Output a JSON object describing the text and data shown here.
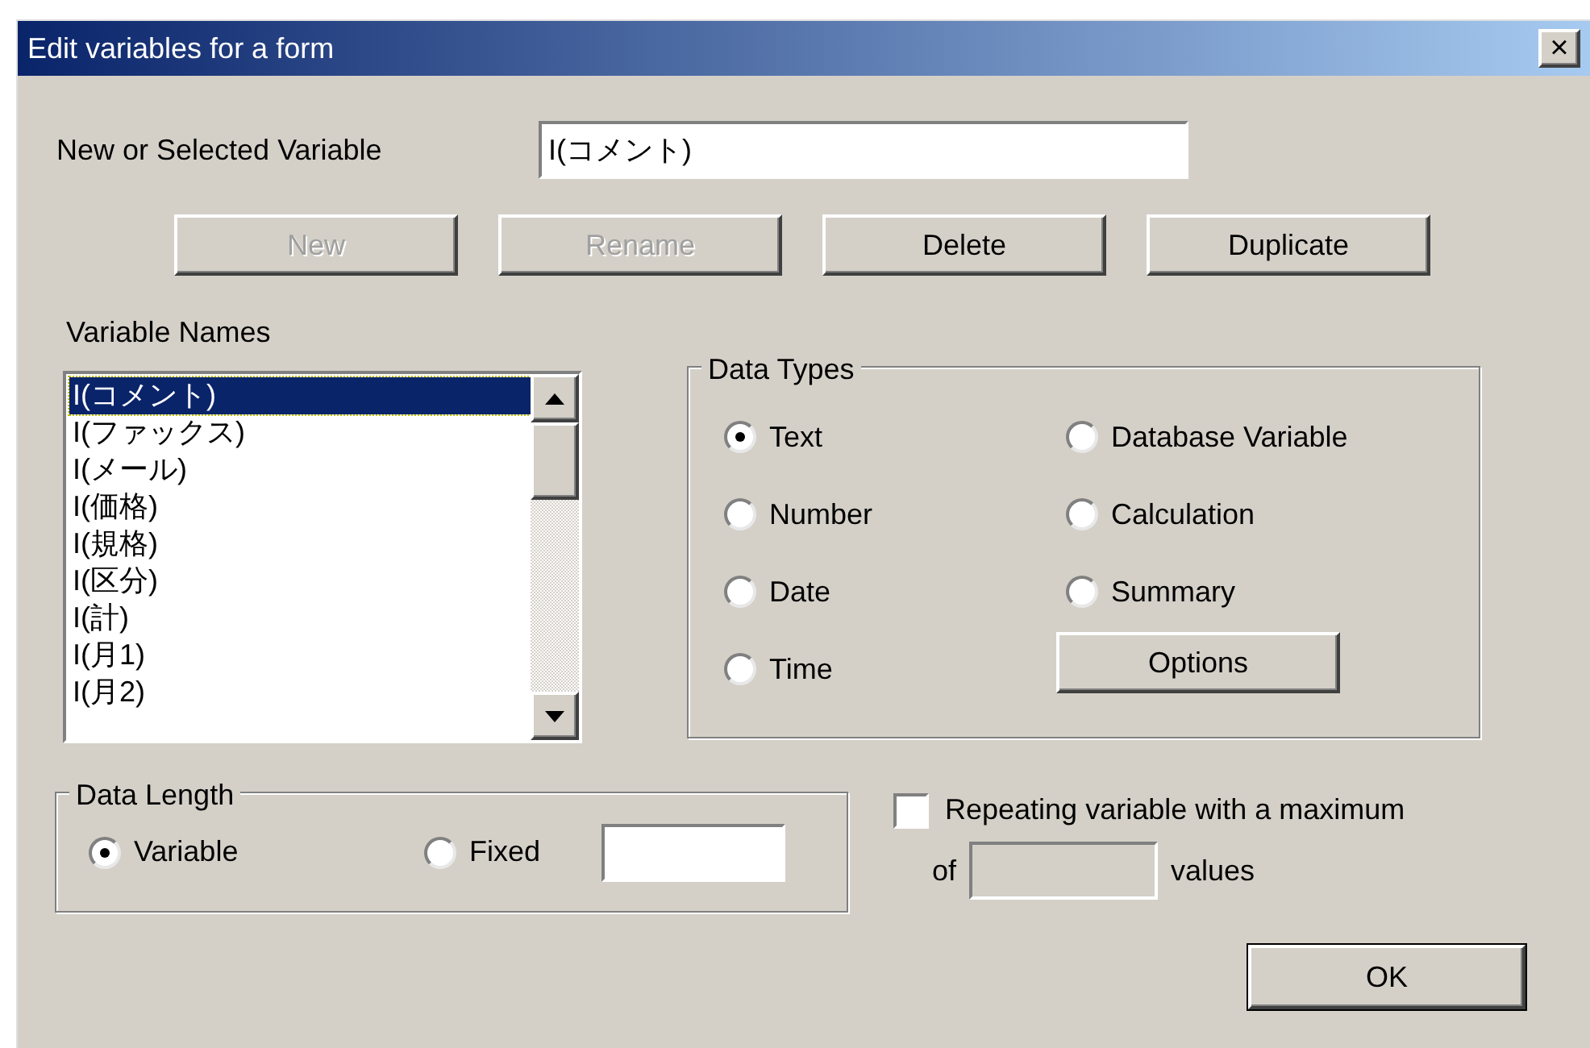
{
  "window": {
    "title": "Edit variables for a form",
    "close": "×"
  },
  "variable": {
    "label": "New or Selected Variable",
    "value": "I(コメント)"
  },
  "buttons": [
    {
      "label": "New",
      "disabled": true
    },
    {
      "label": "Rename",
      "disabled": true
    },
    {
      "label": "Delete",
      "disabled": false
    },
    {
      "label": "Duplicate",
      "disabled": false
    }
  ],
  "variable_names": {
    "label": "Variable Names",
    "items": [
      {
        "label": "I(コメント)",
        "selected": true
      },
      {
        "label": "I(ファックス)",
        "selected": false
      },
      {
        "label": "I(メール)",
        "selected": false
      },
      {
        "label": "I(価格)",
        "selected": false
      },
      {
        "label": "I(規格)",
        "selected": false
      },
      {
        "label": "I(区分)",
        "selected": false
      },
      {
        "label": "I(計)",
        "selected": false
      },
      {
        "label": "I(月1)",
        "selected": false
      },
      {
        "label": "I(月2)",
        "selected": false
      }
    ]
  },
  "data_types": {
    "title": "Data Types",
    "options": [
      {
        "label": "Text",
        "selected": true
      },
      {
        "label": "Database Variable",
        "selected": false
      },
      {
        "label": "Number",
        "selected": false
      },
      {
        "label": "Calculation",
        "selected": false
      },
      {
        "label": "Date",
        "selected": false
      },
      {
        "label": "Summary",
        "selected": false
      },
      {
        "label": "Time",
        "selected": false
      }
    ],
    "button": {
      "label": "Options"
    }
  },
  "data_length": {
    "title": "Data Length",
    "options": [
      {
        "label": "Variable",
        "selected": true
      },
      {
        "label": "Fixed",
        "selected": false
      }
    ]
  },
  "repeating": {
    "label": "Repeating variable with a maximum",
    "checked": false,
    "prefix": "of",
    "suffix": "values"
  },
  "ok": {
    "label": "OK"
  }
}
